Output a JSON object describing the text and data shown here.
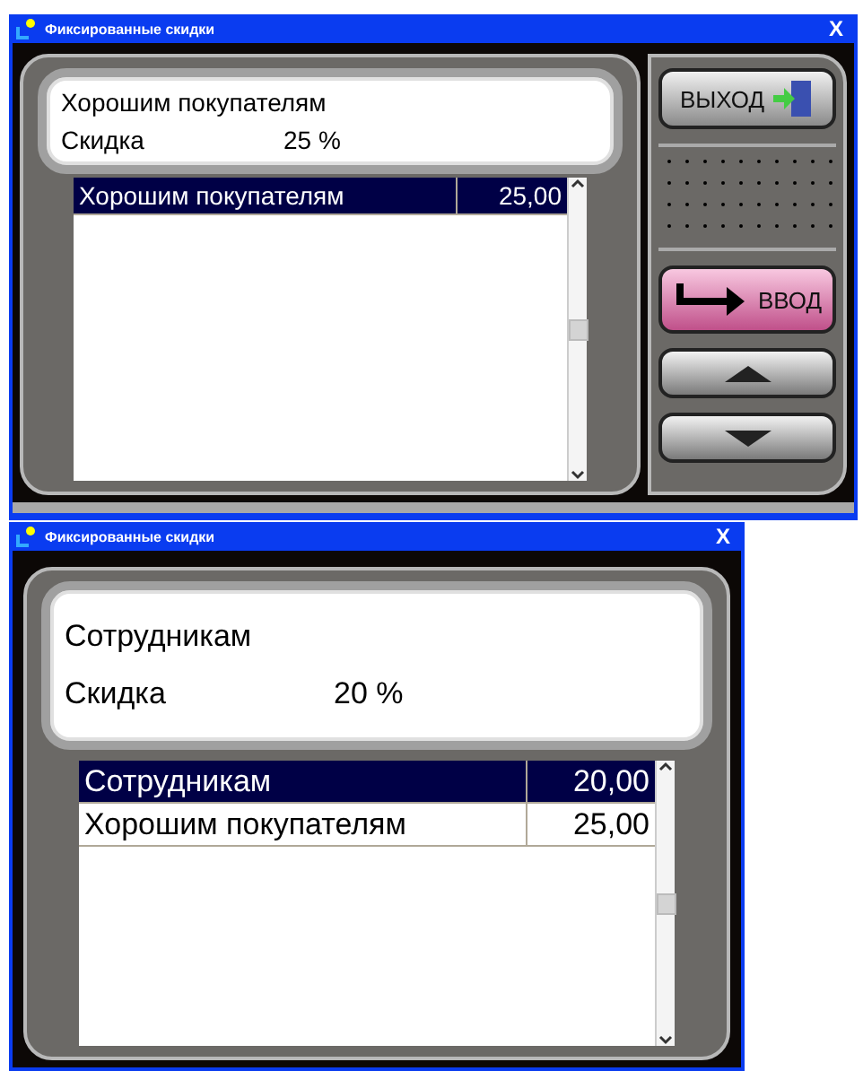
{
  "windows": [
    {
      "title": "Фиксированные скидки",
      "close": "X",
      "info": {
        "name": "Хорошим покупателям",
        "label": "Скидка",
        "value": "25 %"
      },
      "rows": [
        {
          "name": "Хорошим покупателям",
          "amount": "25,00",
          "selected": true
        }
      ],
      "buttons": [
        {
          "kind": "exit",
          "label": "ВЫХОД"
        },
        {
          "kind": "speaker"
        },
        {
          "kind": "enter",
          "label": "ВВОД"
        },
        {
          "kind": "up"
        },
        {
          "kind": "down"
        }
      ]
    },
    {
      "title": "Фиксированные скидки",
      "close": "X",
      "info": {
        "name": "Сотрудникам",
        "label": "Скидка",
        "value": "20 %"
      },
      "rows": [
        {
          "name": "Сотрудникам",
          "amount": "20,00",
          "selected": true
        },
        {
          "name": "Хорошим покупателям",
          "amount": "25,00",
          "selected": false
        }
      ]
    }
  ]
}
